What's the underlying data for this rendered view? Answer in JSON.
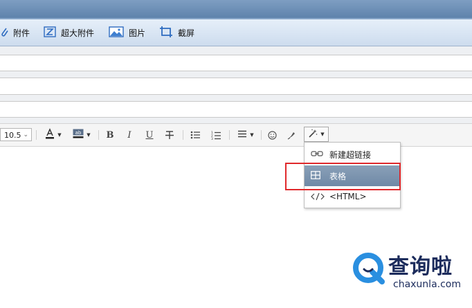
{
  "toolbar": {
    "attach": "附件",
    "big_attach": "超大附件",
    "picture": "图片",
    "screenshot": "截屏"
  },
  "format": {
    "font_size": "10.5"
  },
  "insert_menu": {
    "items": [
      {
        "label": "新建超链接",
        "icon": "link-icon"
      },
      {
        "label": "表格",
        "icon": "table-icon"
      },
      {
        "label": "<HTML>",
        "icon": "code-icon"
      }
    ],
    "highlighted_index": 1
  },
  "watermark": {
    "text": "查询啦",
    "url": "chaxunla.com"
  },
  "colors": {
    "highlight_border": "#e0292c",
    "active_item": "#7a92ae",
    "watermark_navy": "#1c2c5c",
    "watermark_blue": "#2a8fe0"
  }
}
